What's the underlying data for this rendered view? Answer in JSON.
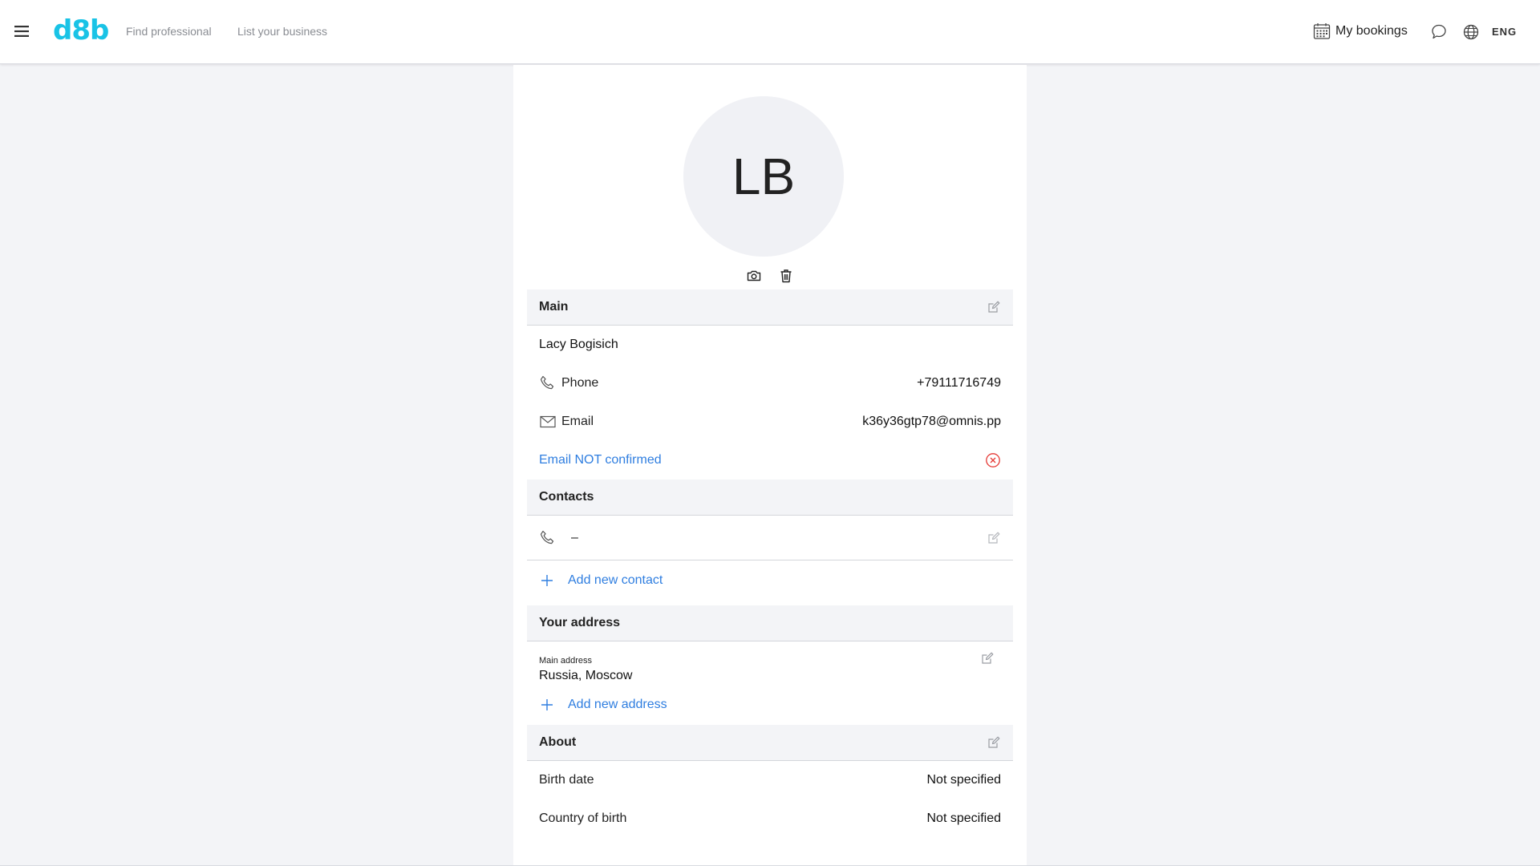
{
  "header": {
    "logo": "d8b",
    "nav": {
      "find_professional": "Find professional",
      "list_business": "List your business"
    },
    "my_bookings": "My bookings",
    "language": "ENG"
  },
  "profile": {
    "initials": "LB",
    "main": {
      "title": "Main",
      "name": "Lacy Bogisich",
      "phone_label": "Phone",
      "phone_value": "+79111716749",
      "email_label": "Email",
      "email_value": "k36y36gtp78@omnis.pp",
      "email_status": "Email NOT confirmed"
    },
    "contacts": {
      "title": "Contacts",
      "items": [
        {
          "value": "–"
        }
      ],
      "add_label": "Add new contact"
    },
    "address": {
      "title": "Your address",
      "main_label": "Main address",
      "main_value": "Russia, Moscow",
      "add_label": "Add new address"
    },
    "about": {
      "title": "About",
      "birth_date_label": "Birth date",
      "birth_date_value": "Not specified",
      "country_label": "Country of birth",
      "country_value": "Not specified"
    }
  },
  "colors": {
    "brand": "#19c3e6",
    "link": "#2f7ee0",
    "error": "#e53935",
    "section_bg": "#f3f4f7"
  }
}
